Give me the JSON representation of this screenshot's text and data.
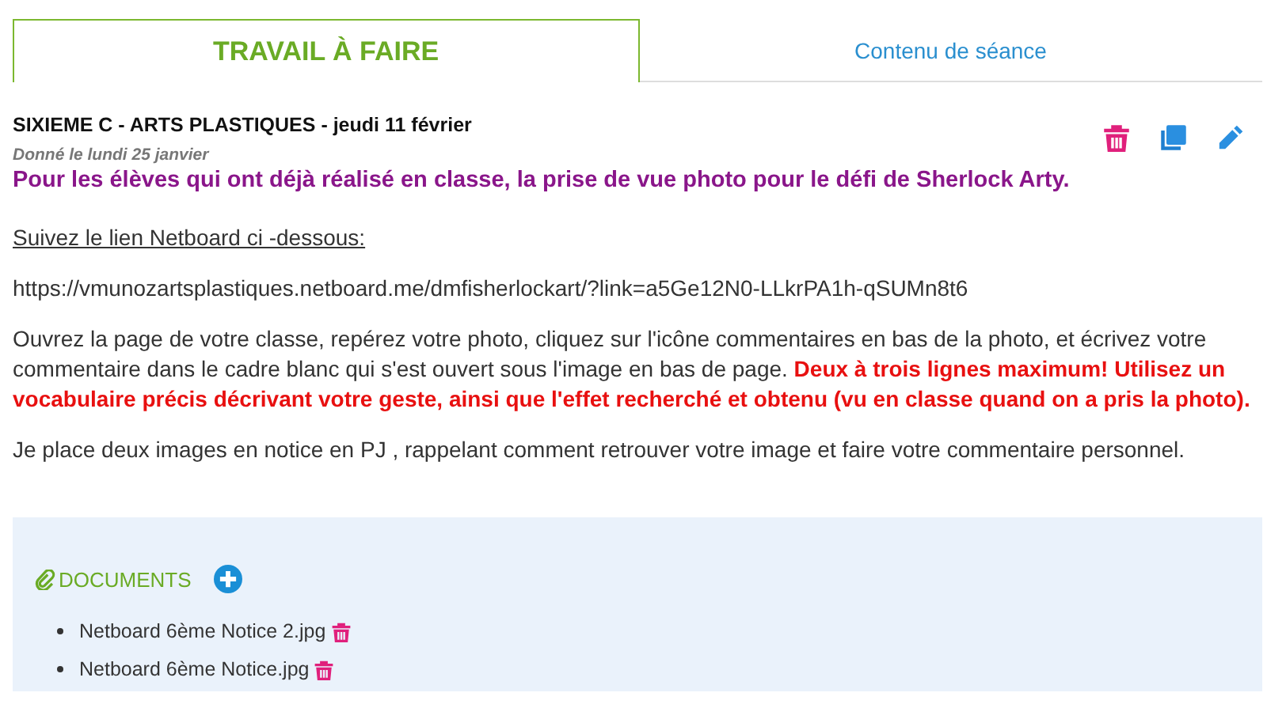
{
  "tabs": [
    {
      "label": "TRAVAIL À FAIRE",
      "selected": true
    },
    {
      "label": "Contenu de séance",
      "selected": false
    }
  ],
  "homework": {
    "heading": "SIXIEME C - ARTS PLASTIQUES - jeudi 11 février",
    "given": "Donné le lundi 25 janvier",
    "paragraphs": [
      {
        "kind": "highlight",
        "text": "Pour les élèves qui ont déjà réalisé en classe, la prise de vue photo pour le défi de Sherlock Arty."
      },
      {
        "kind": "underlined",
        "text": "Suivez le lien Netboard ci -dessous:"
      },
      {
        "kind": "plain",
        "text": "https://vmunozartsplastiques.netboard.me/dmfisherlockart/?link=a5Ge12N0-LLkrPA1h-qSUMn8t6"
      },
      {
        "kind": "plain",
        "text": "Ouvrez la page de votre classe, repérez votre photo, cliquez sur l'icône commentaires en bas de la photo, et écrivez votre commentaire dans le cadre blanc qui s'est ouvert sous l'image en bas de page. **Deux à trois lignes maximum! Utilisez un vocabulaire précis décrivant votre geste, ainsi que l'effet recherché et obtenu (vu en classe quand on a pris la photo).**"
      },
      {
        "kind": "plain",
        "text": "Je place deux images en notice en PJ , rappelant comment retrouver votre image et faire votre commentaire personnel."
      }
    ]
  },
  "documents": {
    "title": "DOCUMENTS",
    "files": [
      "Netboard 6ème Notice 2.jpg",
      "Netboard 6ème Notice.jpg"
    ]
  }
}
